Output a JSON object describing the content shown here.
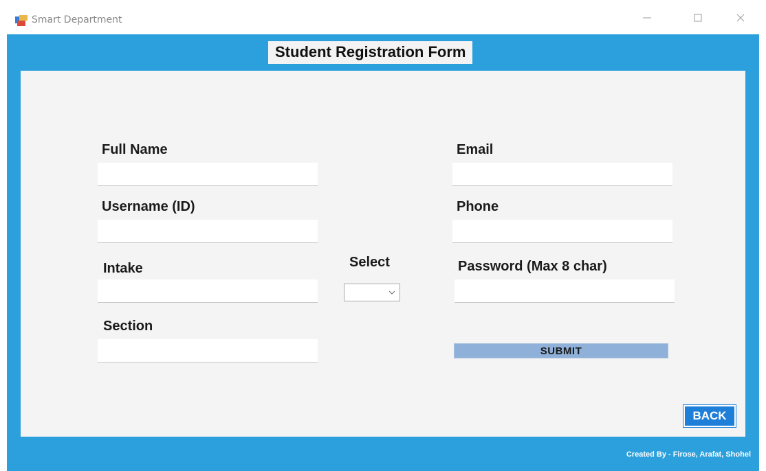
{
  "window": {
    "title": "Smart Department",
    "icon": "app-window-icon"
  },
  "form": {
    "title": "Student Registration Form",
    "labels": {
      "full_name": "Full Name",
      "username": "Username (ID)",
      "intake": "Intake",
      "section": "Section",
      "select": "Select",
      "email": "Email",
      "phone": "Phone",
      "password": "Password (Max 8 char)"
    },
    "values": {
      "full_name": "",
      "username": "",
      "intake": "",
      "section": "",
      "email": "",
      "phone": "",
      "password": "",
      "select": ""
    },
    "submit_label": "SUBMIT",
    "back_label": "BACK"
  },
  "footer": {
    "credits": "Created By - Firose, Arafat, Shohel"
  },
  "colors": {
    "frame": "#2ba0dc",
    "panel": "#f4f4f4",
    "submit": "#8fb1d9",
    "back": "#1e7fd8"
  }
}
